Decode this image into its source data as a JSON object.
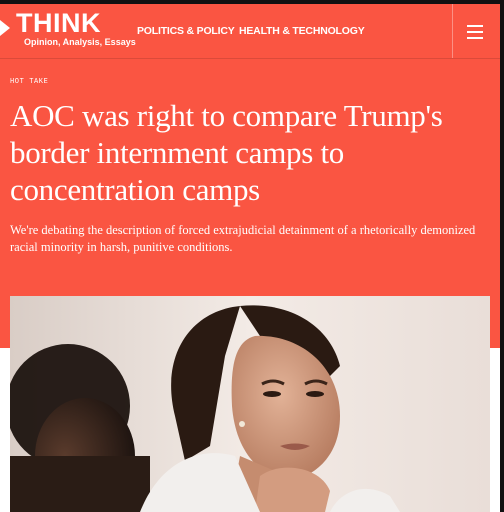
{
  "header": {
    "logo": "THINK",
    "tagline": "Opinion, Analysis, Essays",
    "nav": [
      "POLITICS & POLICY",
      "HEALTH & TECHNOLOGY"
    ],
    "menu_icon": "hamburger-menu-icon"
  },
  "article": {
    "label": "HOT TAKE",
    "headline": "AOC was right to compare Trump's border internment camps to concentration camps",
    "dek": "We're debating the description of forced extrajudicial detainment of a rhetorically demonized racial minority in harsh, punitive conditions."
  },
  "colors": {
    "brand": "#fa5542",
    "text": "#ffffff"
  }
}
